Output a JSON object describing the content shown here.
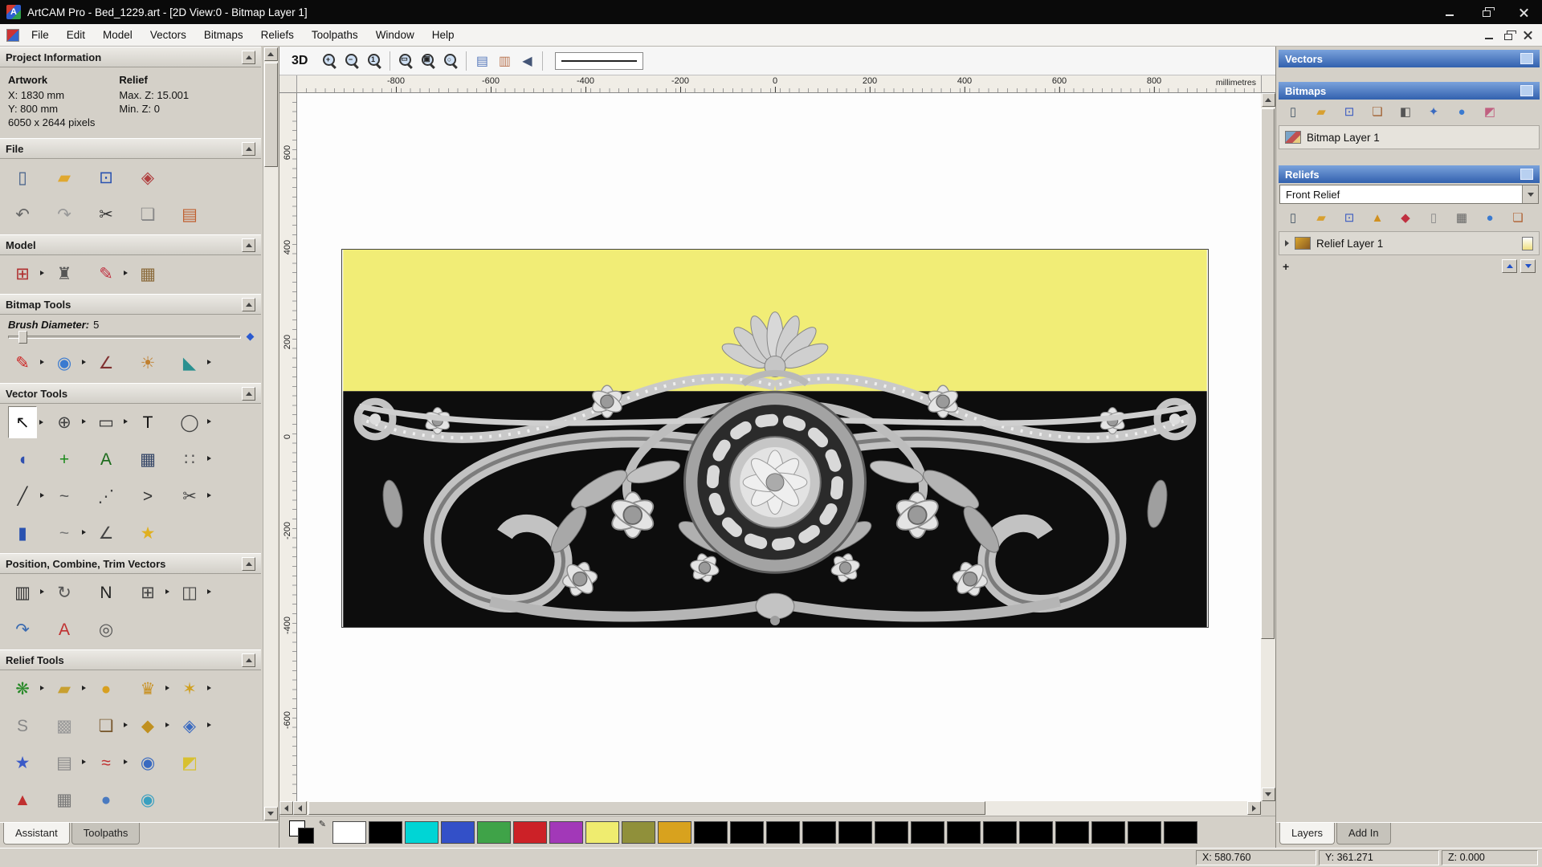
{
  "window": {
    "title": "ArtCAM Pro - Bed_1229.art - [2D View:0 - Bitmap Layer 1]",
    "app_icon_letter": "A",
    "controls": [
      "minimize",
      "restore",
      "close"
    ]
  },
  "menubar": {
    "items": [
      "File",
      "Edit",
      "Model",
      "Vectors",
      "Bitmaps",
      "Reliefs",
      "Toolpaths",
      "Window",
      "Help"
    ]
  },
  "assistant": {
    "titles": {
      "project": "Project Information",
      "file": "File",
      "model": "Model",
      "bitmap": "Bitmap Tools",
      "vector": "Vector Tools",
      "position": "Position, Combine, Trim Vectors",
      "relief": "Relief Tools"
    },
    "project": {
      "artwork_heading": "Artwork",
      "relief_heading": "Relief",
      "artwork_x": "X: 1830 mm",
      "artwork_y": "Y: 800 mm",
      "artwork_pixels": "6050 x 2644 pixels",
      "relief_max_z": "Max. Z: 15.001",
      "relief_min_z": "Min. Z: 0"
    },
    "brush": {
      "label": "Brush Diameter:",
      "value": "5"
    },
    "tabs": [
      {
        "label": "Assistant",
        "active": true
      },
      {
        "label": "Toolpaths",
        "active": false
      }
    ]
  },
  "toolbar": {
    "view3d": "3D",
    "buttons": [
      {
        "t": "mag",
        "n": "zoom-in",
        "m": "+"
      },
      {
        "t": "mag",
        "n": "zoom-out",
        "m": "−"
      },
      {
        "t": "mag",
        "n": "zoom-1to1",
        "m": "1"
      },
      {
        "t": "sep"
      },
      {
        "t": "mag",
        "n": "zoom-window",
        "m": "▭"
      },
      {
        "t": "mag",
        "n": "zoom-drawing",
        "m": "▣"
      },
      {
        "t": "mag",
        "n": "zoom-objects",
        "m": "○"
      },
      {
        "t": "sep"
      },
      {
        "t": "ic",
        "n": "toggle-bitmap-view",
        "g": "▤",
        "c": "#5577bb"
      },
      {
        "t": "ic",
        "n": "toggle-vector-view",
        "g": "▥",
        "c": "#bb7755"
      },
      {
        "t": "ic",
        "n": "previous-view",
        "g": "◀",
        "c": "#445577"
      },
      {
        "t": "sep"
      }
    ]
  },
  "rulers": {
    "unit_label": "millimetres",
    "horizontal": [
      -800,
      -600,
      -400,
      -200,
      0,
      200,
      400,
      600,
      800
    ],
    "vertical": [
      600,
      400,
      200,
      0,
      -200,
      -400,
      -600
    ]
  },
  "artwork_colors": {
    "background_top": "#f1ed76",
    "background_bottom": "#0d0d0d"
  },
  "layers_panel": {
    "vectors_title": "Vectors",
    "bitmaps_title": "Bitmaps",
    "bitmap_layer": "Bitmap Layer 1",
    "reliefs_title": "Reliefs",
    "relief_combo_value": "Front Relief",
    "relief_layer": "Relief Layer 1",
    "tabs": [
      {
        "label": "Layers",
        "active": true
      },
      {
        "label": "Add In",
        "active": false
      }
    ]
  },
  "palette": {
    "colors": [
      "#ffffff",
      "#000000",
      "#00d5d5",
      "#3350c8",
      "#3fa348",
      "#cc2127",
      "#a238b8",
      "#efec6f",
      "#90903a",
      "#d8a21e",
      "#000000",
      "#000000",
      "#000000",
      "#000000",
      "#000000",
      "#000000",
      "#000000",
      "#000000",
      "#000000",
      "#000000",
      "#000000",
      "#000000",
      "#000000",
      "#000000"
    ]
  },
  "statusbar": {
    "x": "X: 580.760",
    "y": "Y: 361.271",
    "z": "Z: 0.000"
  },
  "icons": {
    "pencil_glyph": "✎",
    "plus_glyph": "+",
    "file": [
      [
        {
          "n": "new-model",
          "g": "▯",
          "c": "#44608a"
        },
        {
          "n": "open-model",
          "g": "▰",
          "c": "#e0a830"
        },
        {
          "n": "save-model",
          "g": "⊡",
          "c": "#2a52b0"
        },
        {
          "n": "export-model",
          "g": "◈",
          "c": "#b04040"
        }
      ],
      [
        {
          "n": "undo",
          "g": "↶",
          "c": "#666666"
        },
        {
          "n": "redo",
          "g": "↷",
          "c": "#999999"
        },
        {
          "n": "cut",
          "g": "✂",
          "c": "#333333"
        },
        {
          "n": "copy",
          "g": "❏",
          "c": "#888888"
        },
        {
          "n": "paste",
          "g": "▤",
          "c": "#c06030"
        }
      ]
    ],
    "model": [
      [
        {
          "n": "set-model-size",
          "g": "⊞",
          "c": "#b03030",
          "f": true
        },
        {
          "n": "model-border",
          "g": "♜",
          "c": "#555555"
        },
        {
          "n": "sculpt-model",
          "g": "✎",
          "c": "#c03040",
          "f": true
        },
        {
          "n": "model-texture",
          "g": "▦",
          "c": "#8a6a3a"
        }
      ]
    ],
    "bitmap": [
      [
        {
          "n": "paint-brush",
          "g": "✎",
          "c": "#cc2222",
          "f": true
        },
        {
          "n": "draw-colours",
          "g": "◉",
          "c": "#3a7ad0",
          "f": true
        },
        {
          "n": "colour-picker",
          "g": "∠",
          "c": "#803030"
        },
        {
          "n": "colour-palette",
          "g": "☀",
          "c": "#c08030"
        },
        {
          "n": "flood-fill",
          "g": "◣",
          "c": "#2a9090",
          "f": true
        }
      ]
    ],
    "vector": [
      [
        {
          "n": "select-vectors",
          "g": "↖",
          "c": "#111111",
          "p": true,
          "f": true
        },
        {
          "n": "transform-vectors",
          "g": "⊕",
          "c": "#444444",
          "f": true
        },
        {
          "n": "create-rectangle",
          "g": "▭",
          "c": "#333333",
          "f": true
        },
        {
          "n": "create-text",
          "g": "T",
          "c": "#111111"
        },
        {
          "n": "create-ellipse",
          "g": "◯",
          "c": "#444444",
          "f": true
        }
      ],
      [
        {
          "n": "offset-vector",
          "g": "◖",
          "c": "#3050b0"
        },
        {
          "n": "vector-doctor",
          "g": "+",
          "c": "#1a8a1a"
        },
        {
          "n": "text-in-box",
          "g": "A",
          "c": "#1a6a1a"
        },
        {
          "n": "create-grid",
          "g": "▦",
          "c": "#334466"
        },
        {
          "n": "snap-points",
          "g": "∷",
          "c": "#555555",
          "f": true
        }
      ],
      [
        {
          "n": "create-polyline",
          "g": "╱",
          "c": "#333333",
          "f": true
        },
        {
          "n": "free-sketch",
          "g": "~",
          "c": "#555555"
        },
        {
          "n": "node-editing",
          "g": "⋰",
          "c": "#444444"
        },
        {
          "n": "create-arc",
          "g": ">",
          "c": "#333333"
        },
        {
          "n": "trim-vector",
          "g": "✂",
          "c": "#444444",
          "f": true
        }
      ],
      [
        {
          "n": "create-cylinder",
          "g": "▮",
          "c": "#2a52b0"
        },
        {
          "n": "fit-arcs",
          "g": "~",
          "c": "#777777",
          "f": true
        },
        {
          "n": "measure-tool",
          "g": "∠",
          "c": "#444444"
        },
        {
          "n": "star-wizard",
          "g": "★",
          "c": "#e0b020"
        }
      ]
    ],
    "position": [
      [
        {
          "n": "block-copy",
          "g": "▥",
          "c": "#333333",
          "f": true
        },
        {
          "n": "rotate-copy",
          "g": "↻",
          "c": "#555555"
        },
        {
          "n": "nesting",
          "g": "N",
          "c": "#222222"
        },
        {
          "n": "paste-array",
          "g": "⊞",
          "c": "#444444",
          "f": true
        },
        {
          "n": "weld-vectors",
          "g": "◫",
          "c": "#444444",
          "f": true
        }
      ],
      [
        {
          "n": "mirror-vectors",
          "g": "↷",
          "c": "#3a6ab0"
        },
        {
          "n": "paste-on-curve",
          "g": "A",
          "c": "#c03030"
        },
        {
          "n": "spiral-tool",
          "g": "◎",
          "c": "#555555"
        }
      ]
    ],
    "relief": [
      [
        {
          "n": "shape-editor",
          "g": "❋",
          "c": "#2a8a2a",
          "f": true
        },
        {
          "n": "smooth-relief",
          "g": "▰",
          "c": "#c8a030",
          "f": true
        },
        {
          "n": "dome-relief",
          "g": "●",
          "c": "#d8a020"
        },
        {
          "n": "texture-relief",
          "g": "♛",
          "c": "#c89020",
          "f": true
        },
        {
          "n": "emboss-relief",
          "g": "✶",
          "c": "#d0a020",
          "f": true
        }
      ],
      [
        {
          "n": "smooth-s",
          "g": "S",
          "c": "#888888"
        },
        {
          "n": "weave-relief",
          "g": "▩",
          "c": "#999999"
        },
        {
          "n": "relief-library",
          "g": "❏",
          "c": "#7a5a30",
          "f": true
        },
        {
          "n": "mold-relief",
          "g": "◆",
          "c": "#c09020",
          "f": true
        },
        {
          "n": "lock-relief",
          "g": "◈",
          "c": "#3a6ac0",
          "f": true
        }
      ],
      [
        {
          "n": "star-relief",
          "g": "★",
          "c": "#3a5ac8"
        },
        {
          "n": "envelope-distort",
          "g": "▤",
          "c": "#888888",
          "f": true
        },
        {
          "n": "fan-relief",
          "g": "≈",
          "c": "#c03030",
          "f": true
        },
        {
          "n": "sphere-texture",
          "g": "◉",
          "c": "#3a6ac0"
        },
        {
          "n": "angle-relief",
          "g": "◩",
          "c": "#d8c030"
        }
      ],
      [
        {
          "n": "offset-relief",
          "g": "▲",
          "c": "#c03030"
        },
        {
          "n": "grid-relief",
          "g": "▦",
          "c": "#777777"
        },
        {
          "n": "sphere-relief",
          "g": "●",
          "c": "#4a7ac0"
        },
        {
          "n": "wave-relief",
          "g": "◉",
          "c": "#3aa0c0"
        }
      ]
    ],
    "bitmaps_bar": [
      [
        {
          "n": "new-bitmap-layer",
          "g": "▯",
          "c": "#445566"
        },
        {
          "n": "open-bitmap",
          "g": "▰",
          "c": "#d8a030"
        },
        {
          "n": "save-bitmap",
          "g": "⊡",
          "c": "#3a5ac0"
        },
        {
          "n": "merge-bitmap",
          "g": "❏",
          "c": "#a06030"
        },
        {
          "n": "bitmap-contrast",
          "g": "◧",
          "c": "#555555"
        },
        {
          "n": "bitmap-link",
          "g": "✦",
          "c": "#3a6ac0"
        },
        {
          "n": "bitmap-sphere",
          "g": "●",
          "c": "#3a7ad0"
        },
        {
          "n": "bitmap-colours",
          "g": "◩",
          "c": "#c06080"
        }
      ]
    ],
    "reliefs_bar": [
      [
        {
          "n": "new-relief-layer",
          "g": "▯",
          "c": "#445566"
        },
        {
          "n": "open-relief",
          "g": "▰",
          "c": "#d8a030"
        },
        {
          "n": "save-relief",
          "g": "⊡",
          "c": "#3a5ac0"
        },
        {
          "n": "relief-cone",
          "g": "▲",
          "c": "#d09020"
        },
        {
          "n": "relief-gem",
          "g": "◆",
          "c": "#c03040"
        },
        {
          "n": "relief-page",
          "g": "▯",
          "c": "#888888"
        },
        {
          "n": "relief-calculate",
          "g": "▦",
          "c": "#666666"
        },
        {
          "n": "relief-sphere",
          "g": "●",
          "c": "#3a7ad0"
        },
        {
          "n": "relief-duplicate",
          "g": "❏",
          "c": "#b06030"
        }
      ]
    ]
  }
}
